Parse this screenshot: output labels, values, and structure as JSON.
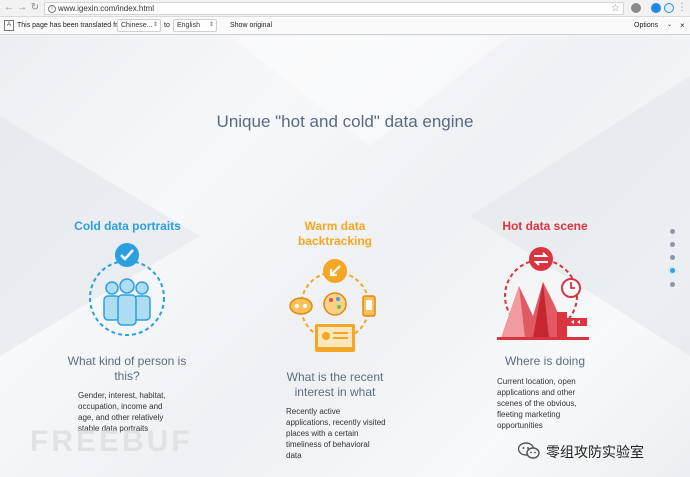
{
  "browser": {
    "url": "www.igexin.com/index.html",
    "back_icon": "back-arrow-icon",
    "forward_icon": "forward-arrow-icon",
    "reload_icon": "reload-icon"
  },
  "translate_bar": {
    "message": "This page has been translated from",
    "from_language": "Chinese...",
    "to_label": "to",
    "to_language": "English",
    "show_original": "Show original",
    "options": "Options"
  },
  "main": {
    "title": "Unique \"hot and cold\" data engine",
    "columns": [
      {
        "title": "Cold data portraits",
        "color": "#2ba0e0",
        "subtitle": "What kind of person is this?",
        "description": "Gender, interest, habitat, occupation, income and age, and other relatively stable data portraits"
      },
      {
        "title": "Warm data backtracking",
        "color": "#f5a623",
        "subtitle": "What is the recent interest in what",
        "description": "Recently active applications, recently visited places with a certain timeliness of behavioral data"
      },
      {
        "title": "Hot data scene",
        "color": "#d9343f",
        "subtitle": "Where is doing",
        "description": "Current location, open applications and other scenes of the obvious, fleeting marketing opportunities"
      }
    ]
  },
  "pagination": {
    "count": 5,
    "active_index": 3
  },
  "watermark": {
    "text": "FREEBUF"
  },
  "wechat": {
    "label": "零组攻防实验室"
  }
}
